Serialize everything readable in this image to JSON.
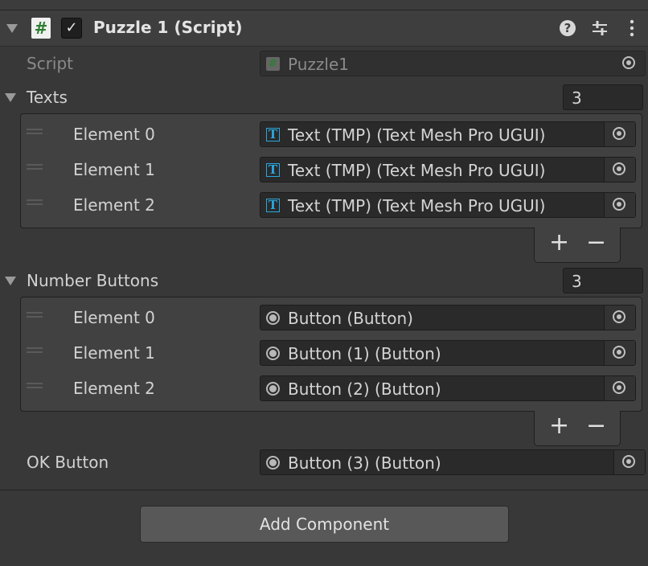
{
  "component": {
    "title": "Puzzle 1 (Script)",
    "enabled_check": "✓",
    "icons": [
      "hash-icon",
      "help-icon",
      "presets-icon",
      "more-icon"
    ]
  },
  "script": {
    "label": "Script",
    "value": "Puzzle1"
  },
  "texts": {
    "label": "Texts",
    "size": "3",
    "items": [
      {
        "label": "Element 0",
        "value": "Text (TMP) (Text Mesh Pro UGUI)"
      },
      {
        "label": "Element 1",
        "value": "Text (TMP) (Text Mesh Pro UGUI)"
      },
      {
        "label": "Element 2",
        "value": "Text (TMP) (Text Mesh Pro UGUI)"
      }
    ],
    "add": "+",
    "remove": "−"
  },
  "number_buttons": {
    "label": "Number Buttons",
    "size": "3",
    "items": [
      {
        "label": "Element 0",
        "value": "Button (Button)"
      },
      {
        "label": "Element 1",
        "value": "Button (1) (Button)"
      },
      {
        "label": "Element 2",
        "value": "Button (2) (Button)"
      }
    ],
    "add": "+",
    "remove": "−"
  },
  "ok_button": {
    "label": "OK Button",
    "value": "Button (3) (Button)"
  },
  "add_component": "Add Component",
  "colors": {
    "background": "#383838",
    "tmp_icon": "#2aa7dd",
    "script_icon": "#2e7d32"
  }
}
